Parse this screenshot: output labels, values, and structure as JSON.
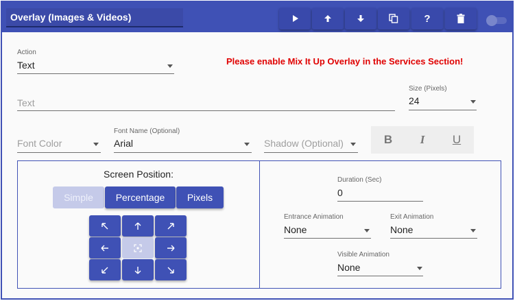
{
  "header": {
    "title": "Overlay (Images & Videos)",
    "buttons": [
      {
        "name": "play-button",
        "icon": "play-icon"
      },
      {
        "name": "move-up-button",
        "icon": "arrow-up-icon"
      },
      {
        "name": "move-down-button",
        "icon": "arrow-down-icon"
      },
      {
        "name": "duplicate-button",
        "icon": "copy-icon"
      },
      {
        "name": "help-button",
        "icon": "question-icon"
      },
      {
        "name": "delete-button",
        "icon": "trash-icon"
      }
    ],
    "help_glyph": "?"
  },
  "action": {
    "label": "Action",
    "value": "Text"
  },
  "warning": "Please enable Mix It Up Overlay in the Services Section!",
  "text_field": {
    "placeholder": "Text"
  },
  "size": {
    "label": "Size (Pixels)",
    "value": "24"
  },
  "font_color": {
    "placeholder": "Font Color"
  },
  "font_name": {
    "label": "Font Name (Optional)",
    "value": "Arial"
  },
  "shadow": {
    "placeholder": "Shadow (Optional)"
  },
  "format": {
    "bold": "B",
    "italic": "I",
    "underline": "U"
  },
  "screen_position": {
    "title": "Screen Position:",
    "modes": [
      "Simple",
      "Percentage",
      "Pixels"
    ],
    "grid": [
      "↖",
      "↑",
      "↗",
      "←",
      "center",
      "→",
      "↙",
      "↓",
      "↘"
    ]
  },
  "duration": {
    "label": "Duration (Sec)",
    "value": "0"
  },
  "entrance_animation": {
    "label": "Entrance Animation",
    "value": "None"
  },
  "exit_animation": {
    "label": "Exit Animation",
    "value": "None"
  },
  "visible_animation": {
    "label": "Visible Animation",
    "value": "None"
  },
  "colors": {
    "accent": "#3f51b5",
    "warning": "#e00000",
    "disabled": "#c5cae9"
  }
}
